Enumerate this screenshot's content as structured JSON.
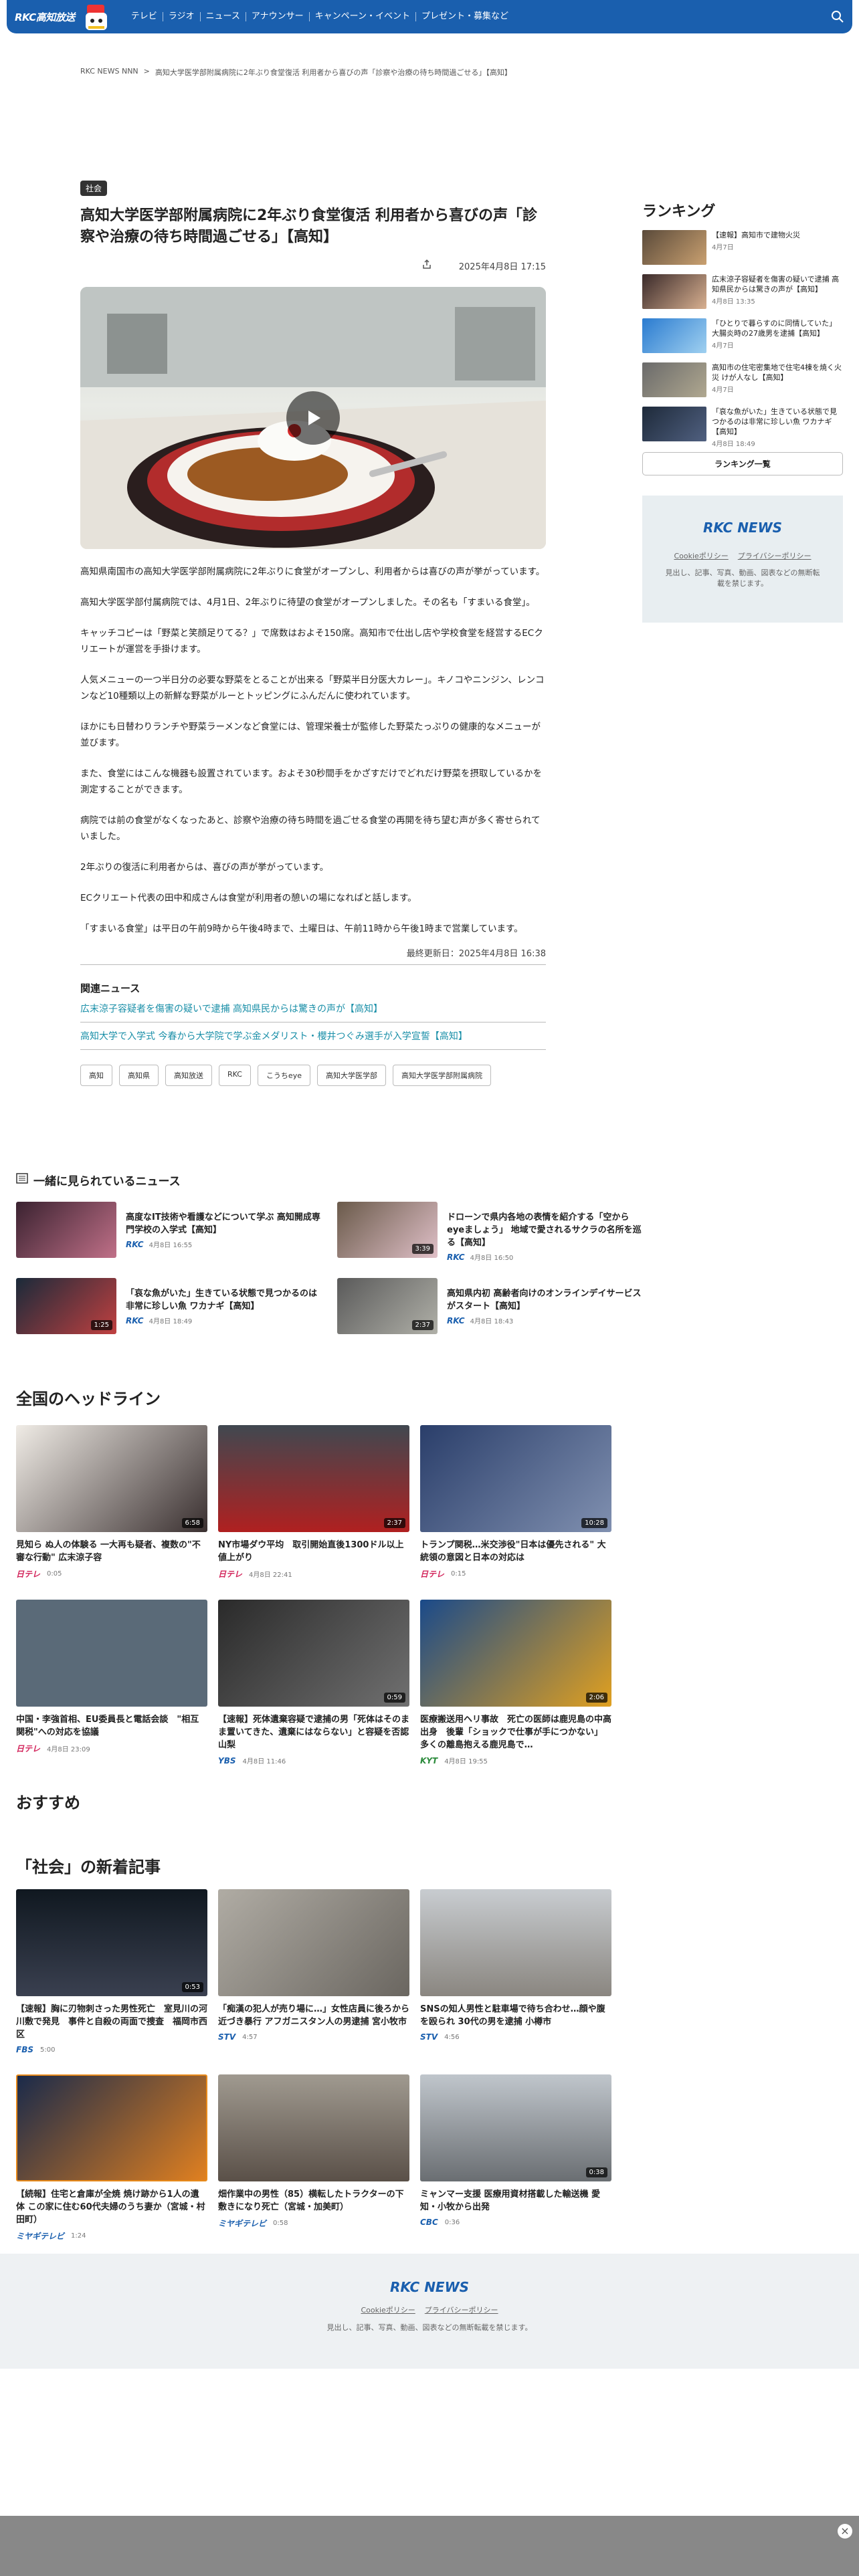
{
  "header": {
    "logo": "RKC高知放送",
    "nav": [
      "テレビ",
      "ラジオ",
      "ニュース",
      "アナウンサー",
      "キャンペーン・イベント",
      "プレゼント・募集など"
    ]
  },
  "breadcrumb": {
    "home": "RKC NEWS NNN",
    "sep": ">",
    "current": "高知大学医学部附属病院に2年ぶり食堂復活 利用者から喜びの声「診察や治療の待ち時間過ごせる」【高知】"
  },
  "article": {
    "category": "社会",
    "title": "高知大学医学部附属病院に2年ぶり食堂復活 利用者から喜びの声「診察や治療の待ち時間過ごせる」【高知】",
    "date": "2025年4月8日 17:15",
    "paragraphs": [
      "高知県南国市の高知大学医学部附属病院に2年ぶりに食堂がオープンし、利用者からは喜びの声が挙がっています。",
      "高知大学医学部付属病院では、4月1日、2年ぶりに待望の食堂がオープンしました。その名も「すまいる食堂」。",
      "キャッチコピーは「野菜と笑顔足りてる？」で席数はおよそ150席。高知市で仕出し店や学校食堂を経営するECクリエートが運営を手掛けます。",
      "人気メニューの一つ半日分の必要な野菜をとることが出来る「野菜半日分医大カレー」。キノコやニンジン、レンコンなど10種類以上の新鮮な野菜がルーとトッピングにふんだんに使われています。",
      "ほかにも日替わりランチや野菜ラーメンなど食堂には、管理栄養士が監修した野菜たっぷりの健康的なメニューが並びます。",
      "また、食堂にはこんな機器も設置されています。およそ30秒間手をかざすだけでどれだけ野菜を摂取しているかを測定することができます。",
      "病院では前の食堂がなくなったあと、診察や治療の待ち時間を過ごせる食堂の再開を待ち望む声が多く寄せられていました。",
      "2年ぶりの復活に利用者からは、喜びの声が挙がっています。",
      "ECクリエート代表の田中和成さんは食堂が利用者の憩いの場になればと話します。",
      "「すまいる食堂」は平日の午前9時から午後4時まで、土曜日は、午前11時から午後1時まで営業しています。"
    ],
    "updated": "最終更新日：2025年4月8日 16:38"
  },
  "related": {
    "heading": "関連ニュース",
    "links": [
      "広末涼子容疑者を傷害の疑いで逮捕 高知県民からは驚きの声が【高知】",
      "高知大学で入学式 今春から大学院で学ぶ金メダリスト・櫻井つぐみ選手が入学宣誓【高知】"
    ]
  },
  "tags": [
    "高知",
    "高知県",
    "高知放送",
    "RKC",
    "こうちeye",
    "高知大学医学部",
    "高知大学医学部附属病院"
  ],
  "ranking": {
    "heading": "ランキング",
    "items": [
      {
        "title": "【速報】高知市で建物火災",
        "date": "4月7日"
      },
      {
        "title": "広末涼子容疑者を傷害の疑いで逮捕 高知県民からは驚きの声が【高知】",
        "date": "4月8日 13:35"
      },
      {
        "title": "「ひとりで暮らすのに同情していた」大腸炎時の27歳男を逮捕【高知】",
        "date": "4月7日"
      },
      {
        "title": "高知市の住宅密集地で住宅4棟を焼く火災 けが人なし【高知】",
        "date": "4月7日"
      },
      {
        "title": "「哀な魚がいた」生きている状態で見つかるのは非常に珍しい魚 ワカナギ【高知】",
        "date": "4月8日 18:49"
      }
    ],
    "more": "ランキング一覧"
  },
  "side_box": {
    "logo": "RKC NEWS",
    "links": [
      "Cookieポリシー",
      "プライバシーポリシー"
    ],
    "copy": "見出し、記事、写真、動画、図表などの無断転載を禁じます。"
  },
  "popular": {
    "heading": "一緒に見られているニュース",
    "items": [
      {
        "title": "高度なIT技術や看護などについて学ぶ 高知開成専門学校の入学式【高知】",
        "src": "RKC",
        "date": "4月8日 16:55",
        "dur": ""
      },
      {
        "title": "ドローンで県内各地の表情を紹介する「空からeyeましょう」 地域で愛されるサクラの名所を巡る【高知】",
        "src": "RKC",
        "date": "4月8日 16:50",
        "dur": "3:39"
      },
      {
        "title": "「哀な魚がいた」生きている状態で見つかるのは非常に珍しい魚 ワカナギ【高知】",
        "src": "RKC",
        "date": "4月8日 18:49",
        "dur": "1:25"
      },
      {
        "title": "高知県内初 高齢者向けのオンラインデイサービスがスタート【高知】",
        "src": "RKC",
        "date": "4月8日 18:43",
        "dur": "2:37"
      }
    ]
  },
  "national": {
    "heading": "全国のヘッドライン",
    "items": [
      {
        "title": "見知ら ぬ人の体験る 一大再も疑者、複数の\"不審な行動\" 広末涼子容",
        "src": "日テレ",
        "date": "0:05",
        "dur": "6:58"
      },
      {
        "title": "NY市場ダウ平均　取引開始直後1300ドル以上値上がり",
        "src": "日テレ",
        "date": "4月8日 22:41",
        "dur": "2:37"
      },
      {
        "title": "トランプ関税…米交渉役\"日本は優先される\" 大統領の意図と日本の対応は",
        "src": "日テレ",
        "date": "0:15",
        "dur": "10:28"
      },
      {
        "title": "中国・李強首相、EU委員長と電話会談　\"相互関税\"への対応を協議",
        "src": "日テレ",
        "date": "4月8日 23:09",
        "dur": ""
      },
      {
        "title": "【速報】死体遺棄容疑で逮捕の男「死体はそのまま置いてきた、遺棄にはならない」と容疑を否認 山梨",
        "src": "YBS",
        "date": "4月8日 11:46",
        "dur": "0:59"
      },
      {
        "title": "医療搬送用ヘリ事故　死亡の医師は鹿児島の中高出身　後輩「ショックで仕事が手につかない」 多くの離島抱える鹿児島で…",
        "src": "KYT",
        "date": "4月8日 19:55",
        "dur": "2:06"
      }
    ]
  },
  "recommend": {
    "heading": "おすすめ"
  },
  "social": {
    "heading": "「社会」の新着記事",
    "items": [
      {
        "title": "【速報】胸に刃物刺さった男性死亡　室見川の河川敷で発見　事件と自殺の両面で捜査　福岡市西区",
        "src": "FBS",
        "date": "5:00",
        "dur": "0:53"
      },
      {
        "title": "「痴漢の犯人が売り場に…」女性店員に後ろから近づき暴行 アフガニスタン人の男逮捕 宮小牧市",
        "src": "STV",
        "date": "4:57",
        "dur": ""
      },
      {
        "title": "SNSの知人男性と駐車場で待ち合わせ…顔や腹を殴られ 30代の男を逮捕 小樽市",
        "src": "STV",
        "date": "4:56",
        "dur": ""
      },
      {
        "title": "【続報】住宅と倉庫が全焼 焼け跡から1人の遺体 この家に住む60代夫婦のうち妻か（宮城・村田町）",
        "src": "ミヤギテレビ",
        "date": "1:24",
        "dur": ""
      },
      {
        "title": "畑作業中の男性（85）横転したトラクターの下敷きになり死亡（宮城・加美町）",
        "src": "ミヤギテレビ",
        "date": "0:58",
        "dur": ""
      },
      {
        "title": "ミャンマー支援 医療用資材搭載した輸送機 愛知・小牧から出発",
        "src": "CBC",
        "date": "0:36",
        "dur": "0:38"
      }
    ]
  },
  "footer": {
    "logo": "RKC NEWS",
    "links": [
      "Cookieポリシー",
      "プライバシーポリシー"
    ],
    "copy": "見出し、記事、写真、動画、図表などの無断転載を禁じます。"
  },
  "ad": {
    "close": "×"
  }
}
